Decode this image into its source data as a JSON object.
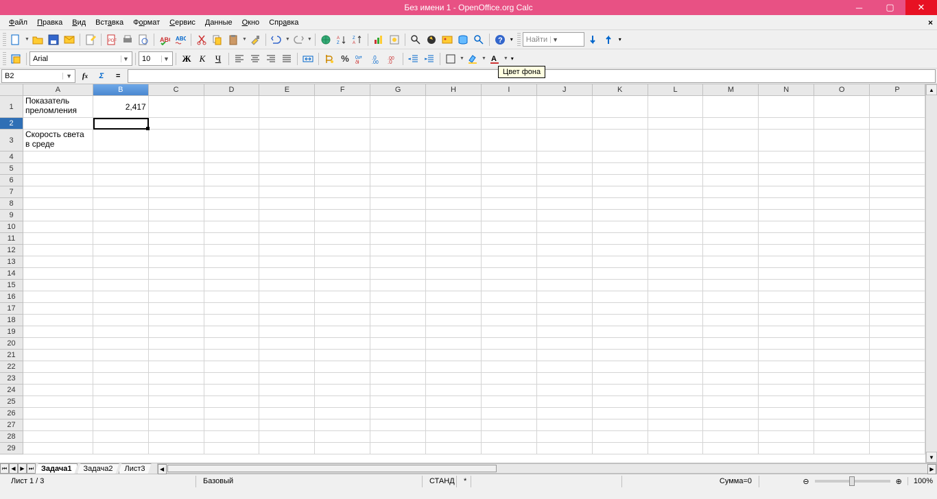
{
  "title": "Без имени 1 - OpenOffice.org Calc",
  "menu": {
    "file": "Файл",
    "edit": "Правка",
    "view": "Вид",
    "insert": "Вставка",
    "format": "Формат",
    "tools": "Сервис",
    "data": "Данные",
    "window": "Окно",
    "help": "Справка"
  },
  "font": {
    "name": "Arial",
    "size": "10"
  },
  "find_placeholder": "Найти",
  "tooltip": "Цвет фона",
  "cellref": "B2",
  "columns": [
    "A",
    "B",
    "C",
    "D",
    "E",
    "F",
    "G",
    "H",
    "I",
    "J",
    "K",
    "L",
    "M",
    "N",
    "O",
    "P"
  ],
  "cells": {
    "A1": "Показатель преломления",
    "B1": "2,417",
    "A3": "Скорость света в среде"
  },
  "selected_col": "B",
  "selected_row": 2,
  "tabs": [
    "Задача1",
    "Задача2",
    "Лист3"
  ],
  "active_tab": 0,
  "status": {
    "sheet": "Лист 1 / 3",
    "style": "Базовый",
    "mode": "СТАНД",
    "mod": "*",
    "sum": "Сумма=0",
    "zoom": "100%"
  }
}
